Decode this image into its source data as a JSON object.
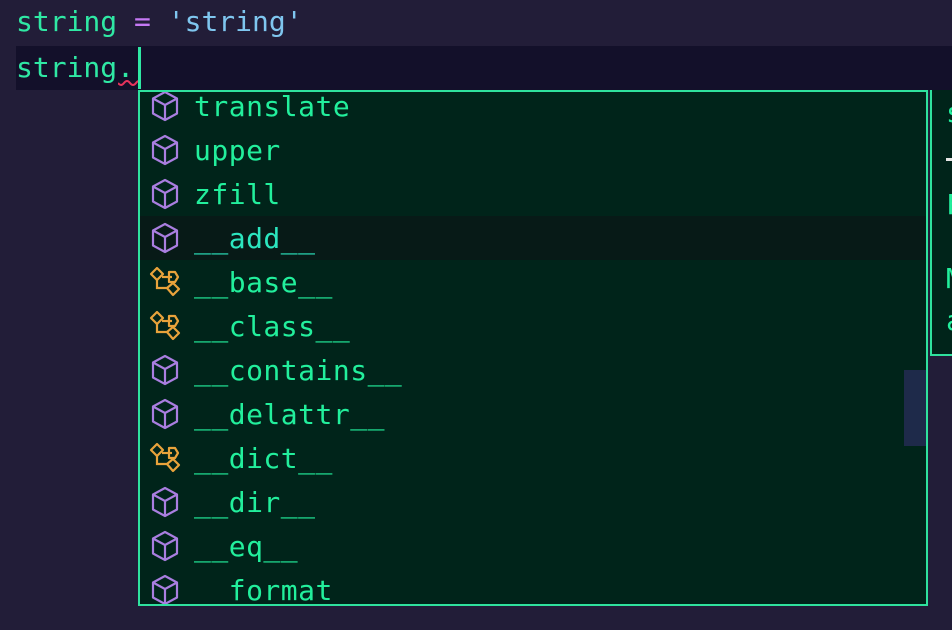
{
  "editor": {
    "line1": {
      "ident": "string",
      "op": " = ",
      "str": "'string'"
    },
    "line2": {
      "ident": "string",
      "dot": "."
    }
  },
  "suggestions": {
    "items": [
      {
        "label": "translate",
        "kind": "method-cube-icon"
      },
      {
        "label": "upper",
        "kind": "method-cube-icon"
      },
      {
        "label": "zfill",
        "kind": "method-cube-icon"
      },
      {
        "label": "__add__",
        "kind": "method-cube-icon",
        "selected": true
      },
      {
        "label": "__base__",
        "kind": "field-class-icon"
      },
      {
        "label": "__class__",
        "kind": "field-class-icon"
      },
      {
        "label": "__contains__",
        "kind": "method-cube-icon"
      },
      {
        "label": "__delattr__",
        "kind": "method-cube-icon"
      },
      {
        "label": "__dict__",
        "kind": "field-class-icon"
      },
      {
        "label": "__dir__",
        "kind": "method-cube-icon"
      },
      {
        "label": "__eq__",
        "kind": "method-cube-icon"
      },
      {
        "label": "__format",
        "kind": "method-cube-icon"
      }
    ]
  },
  "details_panel": {
    "lines": [
      "s",
      "",
      "F",
      "",
      "M",
      "a"
    ]
  },
  "colors": {
    "background": "#221d38",
    "popup_bg": "#00241a",
    "popup_border": "#2fe29e",
    "label": "#22ef9c",
    "cube_icon": "#a97ee0",
    "class_icon": "#e9a33b"
  }
}
